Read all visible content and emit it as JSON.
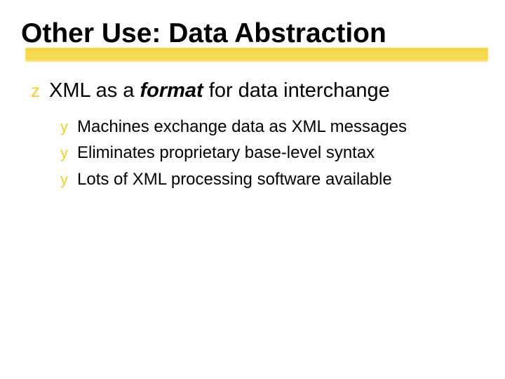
{
  "title": "Other Use: Data Abstraction",
  "main_bullet": {
    "glyph": "z",
    "prefix": "XML as a ",
    "emph": "format",
    "suffix": "  for data interchange"
  },
  "sub_bullets": [
    {
      "glyph": "y",
      "text": "Machines exchange data as XML messages"
    },
    {
      "glyph": "y",
      "text": "Eliminates proprietary base-level syntax"
    },
    {
      "glyph": "y",
      "text": "Lots of XML processing software available"
    }
  ],
  "colors": {
    "accent": "#f3cf2e"
  }
}
